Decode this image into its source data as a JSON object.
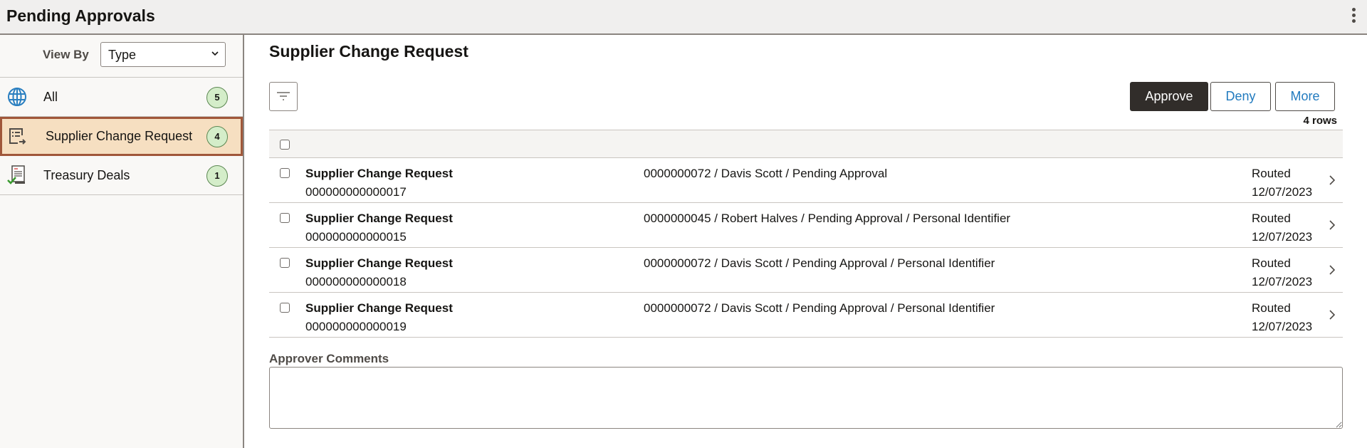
{
  "header": {
    "title": "Pending Approvals",
    "menu_icon": "kebab-vertical-icon"
  },
  "sidebar": {
    "view_by_label": "View By",
    "view_by_value": "Type",
    "items": [
      {
        "label": "All",
        "count": "5",
        "icon": "globe-icon",
        "active": false
      },
      {
        "label": "Supplier Change Request",
        "count": "4",
        "icon": "document-list-icon",
        "active": true
      },
      {
        "label": "Treasury Deals",
        "count": "1",
        "icon": "certificate-check-icon",
        "active": false
      }
    ]
  },
  "main": {
    "title": "Supplier Change Request",
    "actions": {
      "approve": "Approve",
      "deny": "Deny",
      "more": "More"
    },
    "rows_count": "4 rows",
    "rows": [
      {
        "title": "Supplier Change Request",
        "id": "000000000000017",
        "description": "0000000072 / Davis Scott / Pending Approval",
        "status": "Routed",
        "date": "12/07/2023"
      },
      {
        "title": "Supplier Change Request",
        "id": "000000000000015",
        "description": "0000000045 / Robert Halves / Pending Approval / Personal Identifier",
        "status": "Routed",
        "date": "12/07/2023"
      },
      {
        "title": "Supplier Change Request",
        "id": "000000000000018",
        "description": "0000000072 / Davis Scott / Pending Approval / Personal Identifier",
        "status": "Routed",
        "date": "12/07/2023"
      },
      {
        "title": "Supplier Change Request",
        "id": "000000000000019",
        "description": "0000000072 / Davis Scott / Pending Approval / Personal Identifier",
        "status": "Routed",
        "date": "12/07/2023"
      }
    ],
    "comments_label": "Approver Comments",
    "comments_value": ""
  },
  "colors": {
    "active_item_bg": "#f6dfc1",
    "active_item_border": "#a0573a",
    "badge_bg": "#d4edc9",
    "primary_button": "#312d2a",
    "link_blue": "#227bbf"
  }
}
